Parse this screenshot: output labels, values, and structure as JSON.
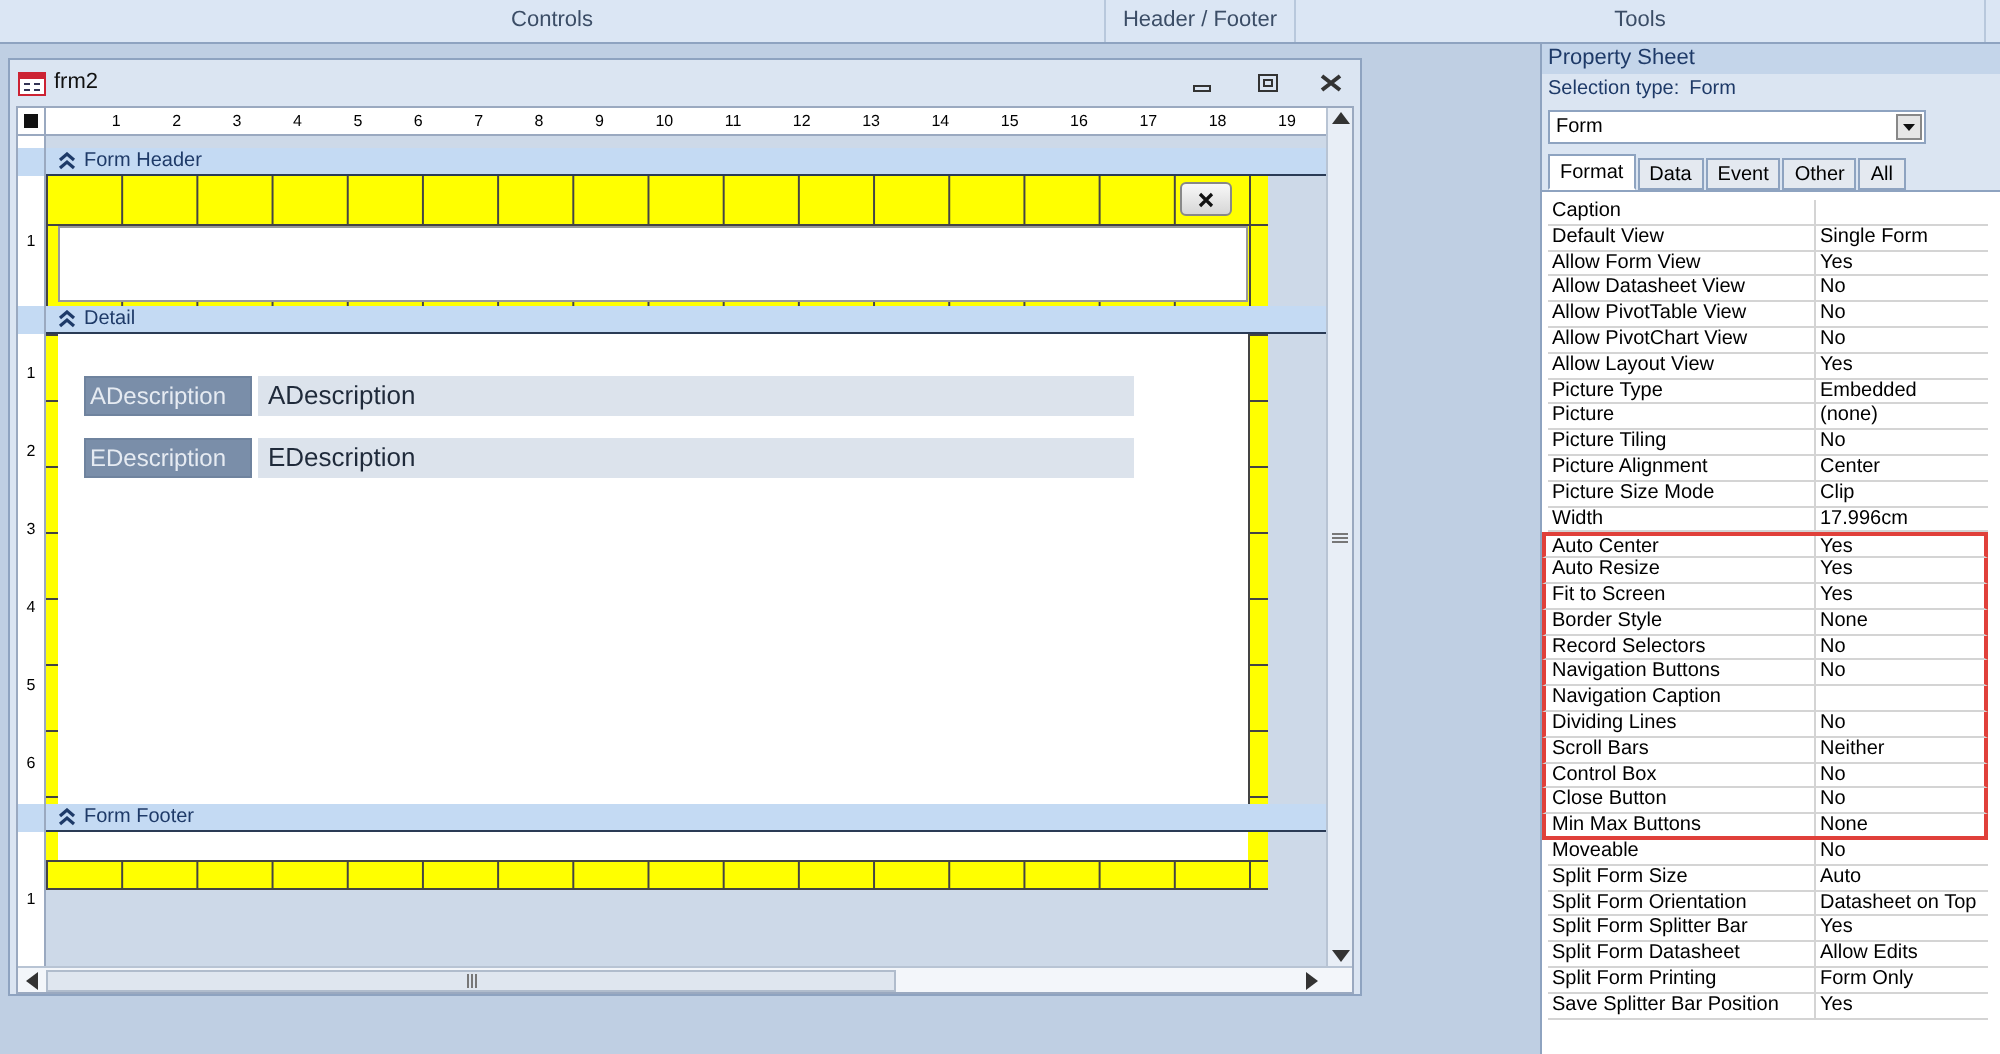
{
  "ribbon": {
    "groups": [
      "Controls",
      "Header / Footer",
      "Tools"
    ]
  },
  "form_window": {
    "title": "frm2",
    "ruler_marks": [
      "1",
      "2",
      "3",
      "4",
      "5",
      "6",
      "7",
      "8",
      "9",
      "10",
      "11",
      "12",
      "13",
      "14",
      "15",
      "16",
      "17",
      "18",
      "19"
    ],
    "sections": [
      {
        "kind": "header",
        "label": "Form Header",
        "ruler_marks": [
          "1"
        ]
      },
      {
        "kind": "detail",
        "label": "Detail",
        "ruler_marks": [
          "1",
          "2",
          "3",
          "4",
          "5",
          "6"
        ],
        "controls": [
          {
            "label": "ADescription",
            "textbox": "ADescription"
          },
          {
            "label": "EDescription",
            "textbox": "EDescription"
          }
        ]
      },
      {
        "kind": "footer",
        "label": "Form Footer",
        "ruler_marks": [
          "1"
        ]
      }
    ]
  },
  "property_sheet": {
    "title": "Property Sheet",
    "selection_type_label": "Selection type:",
    "selection_type": "Form",
    "object": "Form",
    "tabs": [
      {
        "label": "Format",
        "selected": true
      },
      {
        "label": "Data",
        "selected": false
      },
      {
        "label": "Event",
        "selected": false
      },
      {
        "label": "Other",
        "selected": false
      },
      {
        "label": "All",
        "selected": false
      }
    ],
    "rows": [
      {
        "name": "Caption",
        "value": "",
        "highlighted": false
      },
      {
        "name": "Default View",
        "value": "Single Form",
        "highlighted": false
      },
      {
        "name": "Allow Form View",
        "value": "Yes",
        "highlighted": false
      },
      {
        "name": "Allow Datasheet View",
        "value": "No",
        "highlighted": false
      },
      {
        "name": "Allow PivotTable View",
        "value": "No",
        "highlighted": false
      },
      {
        "name": "Allow PivotChart View",
        "value": "No",
        "highlighted": false
      },
      {
        "name": "Allow Layout View",
        "value": "Yes",
        "highlighted": false
      },
      {
        "name": "Picture Type",
        "value": "Embedded",
        "highlighted": false
      },
      {
        "name": "Picture",
        "value": "(none)",
        "highlighted": false
      },
      {
        "name": "Picture Tiling",
        "value": "No",
        "highlighted": false
      },
      {
        "name": "Picture Alignment",
        "value": "Center",
        "highlighted": false
      },
      {
        "name": "Picture Size Mode",
        "value": "Clip",
        "highlighted": false
      },
      {
        "name": "Width",
        "value": "17.996cm",
        "highlighted": false
      },
      {
        "name": "Auto Center",
        "value": "Yes",
        "highlighted": true
      },
      {
        "name": "Auto Resize",
        "value": "Yes",
        "highlighted": true
      },
      {
        "name": "Fit to Screen",
        "value": "Yes",
        "highlighted": true
      },
      {
        "name": "Border Style",
        "value": "None",
        "highlighted": true
      },
      {
        "name": "Record Selectors",
        "value": "No",
        "highlighted": true
      },
      {
        "name": "Navigation Buttons",
        "value": "No",
        "highlighted": true
      },
      {
        "name": "Navigation Caption",
        "value": "",
        "highlighted": true
      },
      {
        "name": "Dividing Lines",
        "value": "No",
        "highlighted": true
      },
      {
        "name": "Scroll Bars",
        "value": "Neither",
        "highlighted": true
      },
      {
        "name": "Control Box",
        "value": "No",
        "highlighted": true
      },
      {
        "name": "Close Button",
        "value": "No",
        "highlighted": true
      },
      {
        "name": "Min Max Buttons",
        "value": "None",
        "highlighted": true
      },
      {
        "name": "Moveable",
        "value": "No",
        "highlighted": false
      },
      {
        "name": "Split Form Size",
        "value": "Auto",
        "highlighted": false
      },
      {
        "name": "Split Form Orientation",
        "value": "Datasheet on Top",
        "highlighted": false
      },
      {
        "name": "Split Form Splitter Bar",
        "value": "Yes",
        "highlighted": false
      },
      {
        "name": "Split Form Datasheet",
        "value": "Allow Edits",
        "highlighted": false
      },
      {
        "name": "Split Form Printing",
        "value": "Form Only",
        "highlighted": false
      },
      {
        "name": "Save Splitter Bar Position",
        "value": "Yes",
        "highlighted": false
      }
    ]
  }
}
